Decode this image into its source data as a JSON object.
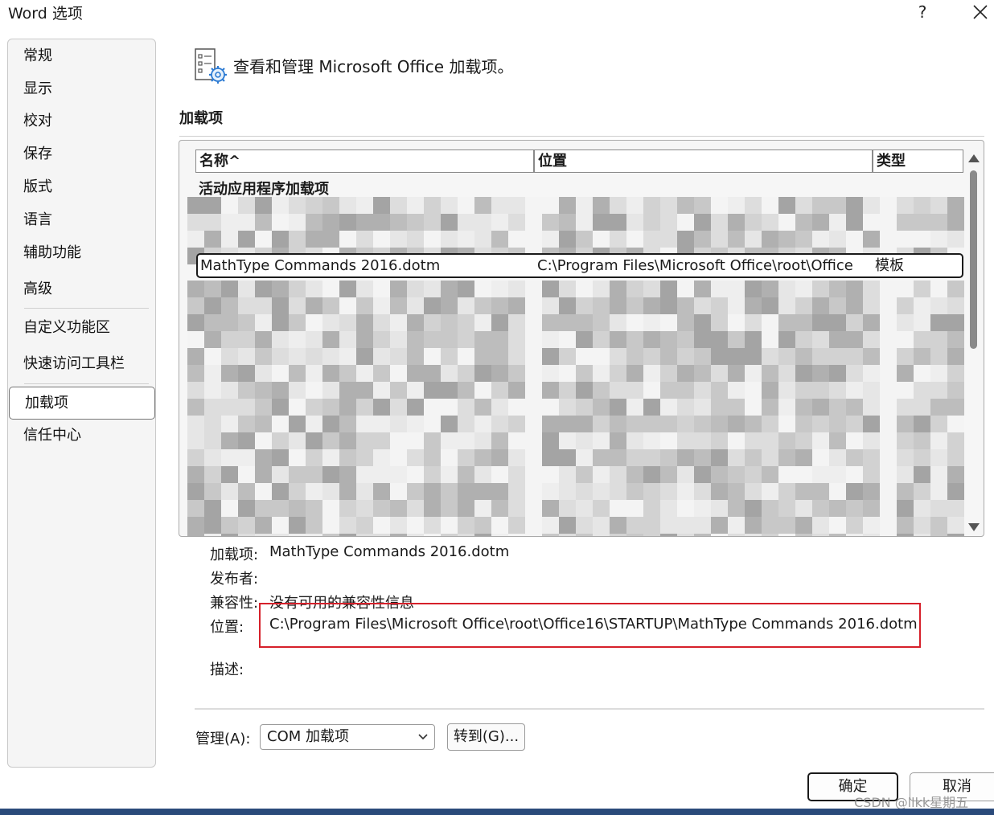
{
  "window": {
    "title": "Word 选项",
    "help_label": "?"
  },
  "sidebar": {
    "items": [
      {
        "label": "常规"
      },
      {
        "label": "显示"
      },
      {
        "label": "校对"
      },
      {
        "label": "保存"
      },
      {
        "label": "版式"
      },
      {
        "label": "语言"
      },
      {
        "label": "辅助功能"
      },
      {
        "label": "高级"
      },
      {
        "label": "自定义功能区"
      },
      {
        "label": "快速访问工具栏"
      },
      {
        "label": "加载项",
        "selected": true
      },
      {
        "label": "信任中心"
      }
    ]
  },
  "main": {
    "header_text": "查看和管理 Microsoft Office 加载项。",
    "section_title": "加载项",
    "table": {
      "columns": [
        "名称^",
        "位置",
        "类型"
      ],
      "group_label": "活动应用程序加载项",
      "selected_row": {
        "name": "MathType Commands 2016.dotm",
        "location": "C:\\Program Files\\Microsoft Office\\root\\Office",
        "type": "模板"
      }
    },
    "details": {
      "addin_label": "加载项:",
      "addin_value": "MathType Commands 2016.dotm",
      "publisher_label": "发布者:",
      "publisher_value": "",
      "compat_label": "兼容性:",
      "compat_value": "没有可用的兼容性信息",
      "location_label": "位置:",
      "location_value": "C:\\Program Files\\Microsoft Office\\root\\Office16\\STARTUP\\MathType Commands 2016.dotm",
      "desc_label": "描述:",
      "desc_value": ""
    },
    "manage": {
      "label": "管理(A):",
      "selected": "COM 加载项",
      "goto_label": "转到(G)..."
    }
  },
  "footer": {
    "ok_label": "确定",
    "cancel_label": "取消",
    "watermark": "CSDN @llkk星期五"
  },
  "colors": {
    "highlight_border": "#d6202a",
    "sidebar_bg": "#f5f5f5"
  }
}
